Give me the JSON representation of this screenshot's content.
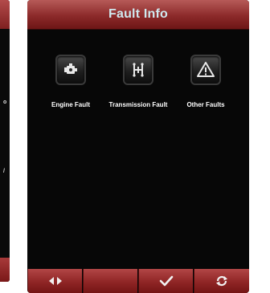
{
  "left_screen": {
    "fragment_top": "o",
    "fragment_bottom": "/"
  },
  "header": {
    "title": "Fault Info",
    "title_color": "#cfe9ef",
    "bar_color": "#8c2a2a"
  },
  "faults": [
    {
      "label": "Engine Fault",
      "icon": "engine-icon"
    },
    {
      "label": "Transmission Fault",
      "icon": "transmission-icon"
    },
    {
      "label": "Other Faults",
      "icon": "warning-triangle-icon"
    }
  ],
  "footer": {
    "buttons": [
      {
        "icon": "left-right-arrows-icon"
      },
      {
        "icon": "blank"
      },
      {
        "icon": "checkmark-icon"
      },
      {
        "icon": "refresh-icon"
      }
    ]
  }
}
